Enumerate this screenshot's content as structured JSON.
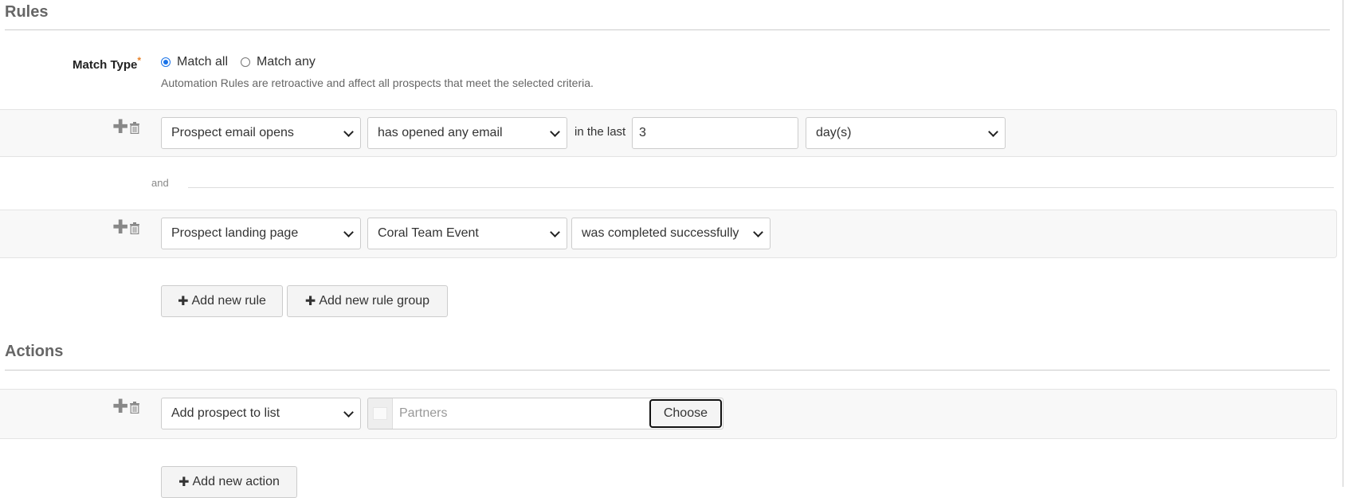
{
  "rules": {
    "title": "Rules",
    "match_type": {
      "label": "Match Type",
      "required_mark": "*",
      "options": [
        {
          "label": "Match all",
          "selected": true
        },
        {
          "label": "Match any",
          "selected": false
        }
      ],
      "hint": "Automation Rules are retroactive and affect all prospects that meet the selected criteria."
    },
    "rule_rows": [
      {
        "field": "Prospect email opens",
        "operator": "has opened any email",
        "middle_label": "in the last",
        "value": "3",
        "unit": "day(s)"
      },
      {
        "field": "Prospect landing page",
        "operator": "Coral Team Event",
        "status": "was completed successfully"
      }
    ],
    "connector": "and",
    "add_rule_label": "Add new rule",
    "add_rule_group_label": "Add new rule group"
  },
  "actions": {
    "title": "Actions",
    "rows": [
      {
        "action": "Add prospect to list",
        "list_placeholder": "Partners",
        "choose_label": "Choose"
      }
    ],
    "add_action_label": "Add new action"
  },
  "icons": {
    "plus": "✚",
    "add": "+"
  },
  "colors": {
    "accent": "#1a73e8",
    "required": "#e8822a"
  }
}
